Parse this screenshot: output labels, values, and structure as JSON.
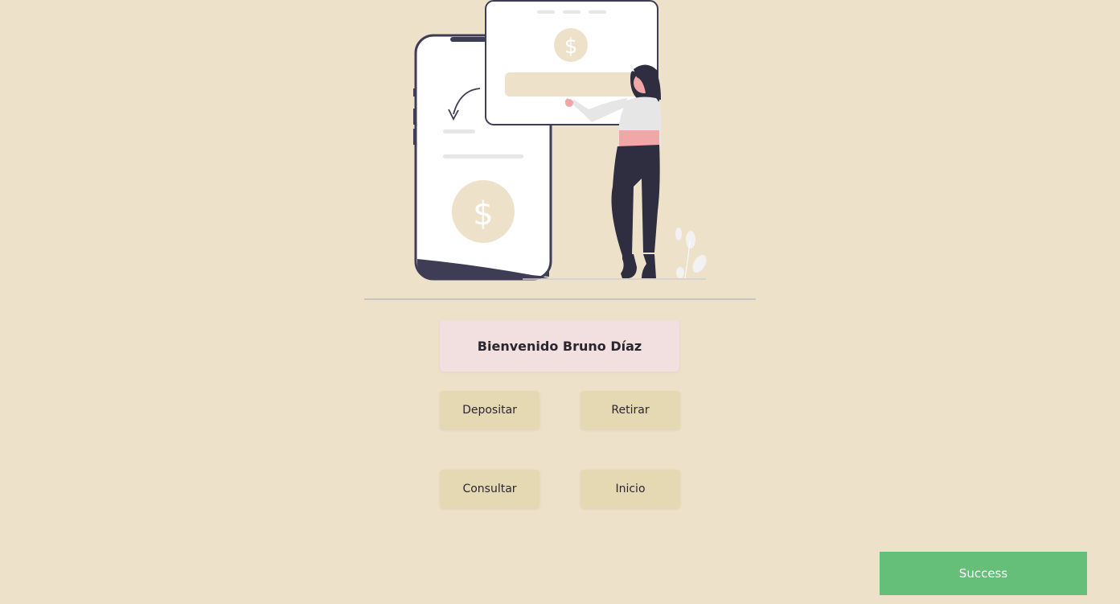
{
  "welcome": {
    "text": "Bienvenido Bruno Díaz"
  },
  "actions": {
    "deposit_label": "Depositar",
    "withdraw_label": "Retirar",
    "consult_label": "Consultar",
    "home_label": "Inicio"
  },
  "toast": {
    "message": "Success"
  },
  "colors": {
    "background": "#ede2c9",
    "button": "#e5d9b4",
    "welcome_box": "#f2dfdf",
    "toast": "#66bf78",
    "dark": "#3f3d56",
    "accent_pink": "#f2a7a7"
  },
  "illustration": {
    "icons": [
      "phone-icon",
      "dollar-coin-icon",
      "browser-window-icon",
      "woman-figure",
      "plant-icon"
    ]
  }
}
